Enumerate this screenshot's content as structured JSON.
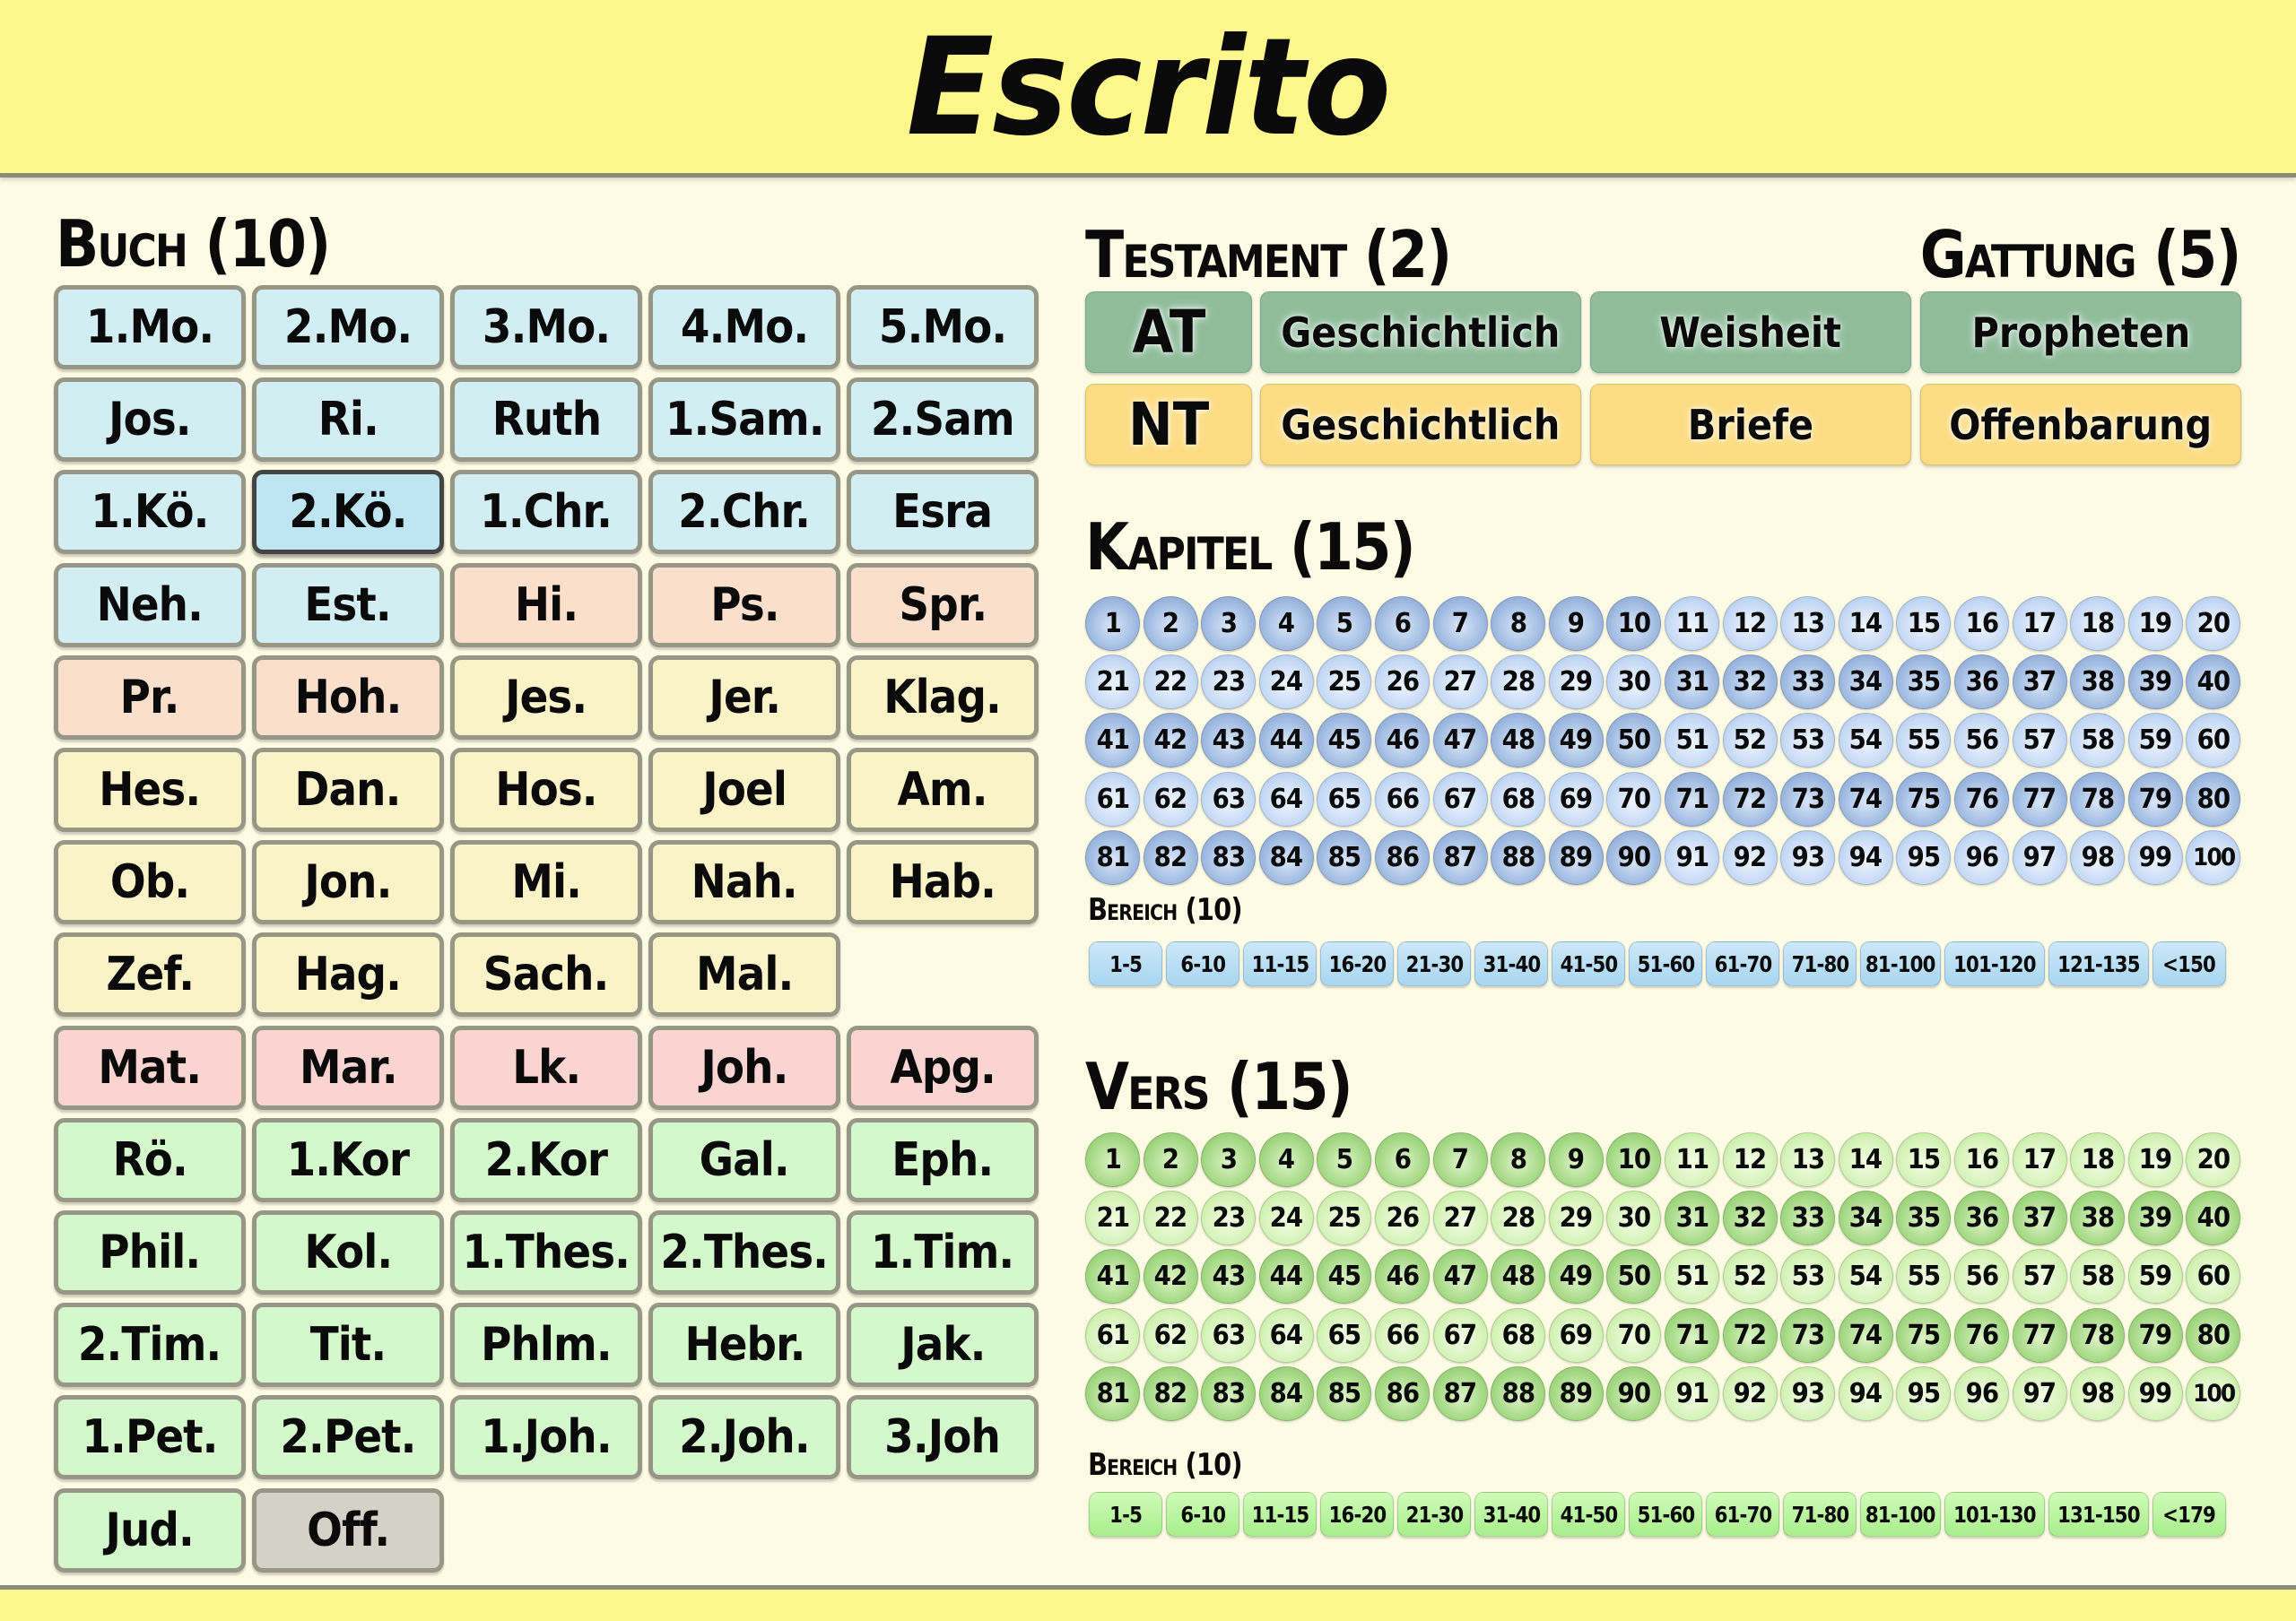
{
  "app": {
    "title": "Escrito"
  },
  "colors": {
    "header_bg": "#fef88c",
    "page_bg": "#fdfbe3",
    "book_groups": {
      "history_ot": "#d2eef2",
      "wisdom": "#fae0cc",
      "prophets": "#fbf3c8",
      "gospels": "#f9d4d0",
      "letters": "#d4f8cc",
      "revelation": "#d4d2c8"
    },
    "at_tile": "#8fbd9b",
    "nt_tile": "#fcdc82"
  },
  "buch": {
    "title": "Buch (10)",
    "selected": "2.Kö.",
    "books": [
      {
        "label": "1.Mo.",
        "group": "history_ot"
      },
      {
        "label": "2.Mo.",
        "group": "history_ot"
      },
      {
        "label": "3.Mo.",
        "group": "history_ot"
      },
      {
        "label": "4.Mo.",
        "group": "history_ot"
      },
      {
        "label": "5.Mo.",
        "group": "history_ot"
      },
      {
        "label": "Jos.",
        "group": "history_ot"
      },
      {
        "label": "Ri.",
        "group": "history_ot"
      },
      {
        "label": "Ruth",
        "group": "history_ot"
      },
      {
        "label": "1.Sam.",
        "group": "history_ot"
      },
      {
        "label": "2.Sam",
        "group": "history_ot"
      },
      {
        "label": "1.Kö.",
        "group": "history_ot"
      },
      {
        "label": "2.Kö.",
        "group": "history_ot"
      },
      {
        "label": "1.Chr.",
        "group": "history_ot"
      },
      {
        "label": "2.Chr.",
        "group": "history_ot"
      },
      {
        "label": "Esra",
        "group": "history_ot"
      },
      {
        "label": "Neh.",
        "group": "history_ot"
      },
      {
        "label": "Est.",
        "group": "history_ot"
      },
      {
        "label": "Hi.",
        "group": "wisdom"
      },
      {
        "label": "Ps.",
        "group": "wisdom"
      },
      {
        "label": "Spr.",
        "group": "wisdom"
      },
      {
        "label": "Pr.",
        "group": "wisdom"
      },
      {
        "label": "Hoh.",
        "group": "wisdom"
      },
      {
        "label": "Jes.",
        "group": "prophets"
      },
      {
        "label": "Jer.",
        "group": "prophets"
      },
      {
        "label": "Klag.",
        "group": "prophets"
      },
      {
        "label": "Hes.",
        "group": "prophets"
      },
      {
        "label": "Dan.",
        "group": "prophets"
      },
      {
        "label": "Hos.",
        "group": "prophets"
      },
      {
        "label": "Joel",
        "group": "prophets"
      },
      {
        "label": "Am.",
        "group": "prophets"
      },
      {
        "label": "Ob.",
        "group": "prophets"
      },
      {
        "label": "Jon.",
        "group": "prophets"
      },
      {
        "label": "Mi.",
        "group": "prophets"
      },
      {
        "label": "Nah.",
        "group": "prophets"
      },
      {
        "label": "Hab.",
        "group": "prophets"
      },
      {
        "label": "Zef.",
        "group": "prophets"
      },
      {
        "label": "Hag.",
        "group": "prophets"
      },
      {
        "label": "Sach.",
        "group": "prophets"
      },
      {
        "label": "Mal.",
        "group": "prophets"
      },
      null,
      {
        "label": "Mat.",
        "group": "gospels"
      },
      {
        "label": "Mar.",
        "group": "gospels"
      },
      {
        "label": "Lk.",
        "group": "gospels"
      },
      {
        "label": "Joh.",
        "group": "gospels"
      },
      {
        "label": "Apg.",
        "group": "gospels"
      },
      {
        "label": "Rö.",
        "group": "letters"
      },
      {
        "label": "1.Kor",
        "group": "letters"
      },
      {
        "label": "2.Kor",
        "group": "letters"
      },
      {
        "label": "Gal.",
        "group": "letters"
      },
      {
        "label": "Eph.",
        "group": "letters"
      },
      {
        "label": "Phil.",
        "group": "letters"
      },
      {
        "label": "Kol.",
        "group": "letters"
      },
      {
        "label": "1.Thes.",
        "group": "letters"
      },
      {
        "label": "2.Thes.",
        "group": "letters"
      },
      {
        "label": "1.Tim.",
        "group": "letters"
      },
      {
        "label": "2.Tim.",
        "group": "letters"
      },
      {
        "label": "Tit.",
        "group": "letters"
      },
      {
        "label": "Phlm.",
        "group": "letters"
      },
      {
        "label": "Hebr.",
        "group": "letters"
      },
      {
        "label": "Jak.",
        "group": "letters"
      },
      {
        "label": "1.Pet.",
        "group": "letters"
      },
      {
        "label": "2.Pet.",
        "group": "letters"
      },
      {
        "label": "1.Joh.",
        "group": "letters"
      },
      {
        "label": "2.Joh.",
        "group": "letters"
      },
      {
        "label": "3.Joh",
        "group": "letters"
      },
      {
        "label": "Jud.",
        "group": "letters"
      },
      {
        "label": "Off.",
        "group": "revelation"
      }
    ]
  },
  "testament": {
    "title": "Testament (2)",
    "items": [
      {
        "label": "AT",
        "tone": "at"
      },
      {
        "label": "NT",
        "tone": "nt"
      }
    ]
  },
  "gattung": {
    "title": "Gattung (5)",
    "at": [
      "Geschichtlich",
      "Weisheit",
      "Propheten"
    ],
    "nt": [
      "Geschichtlich",
      "Briefe",
      "Offenbarung"
    ]
  },
  "kapitel": {
    "title": "Kapitel (15)",
    "count": 100,
    "dark_ranges": [
      [
        1,
        10
      ],
      [
        31,
        50
      ],
      [
        71,
        90
      ]
    ],
    "bereich": {
      "title": "Bereich (10)",
      "ranges": [
        "1-5",
        "6-10",
        "11-15",
        "16-20",
        "21-30",
        "31-40",
        "41-50",
        "51-60",
        "61-70",
        "71-80",
        "81-100",
        "101-120",
        "121-135",
        "<150"
      ]
    }
  },
  "vers": {
    "title": "Vers (15)",
    "count": 100,
    "dark_ranges": [
      [
        1,
        10
      ],
      [
        31,
        50
      ],
      [
        71,
        90
      ]
    ],
    "bereich": {
      "title": "Bereich (10)",
      "ranges": [
        "1-5",
        "6-10",
        "11-15",
        "16-20",
        "21-30",
        "31-40",
        "41-50",
        "51-60",
        "61-70",
        "71-80",
        "81-100",
        "101-130",
        "131-150",
        "<179"
      ]
    }
  }
}
